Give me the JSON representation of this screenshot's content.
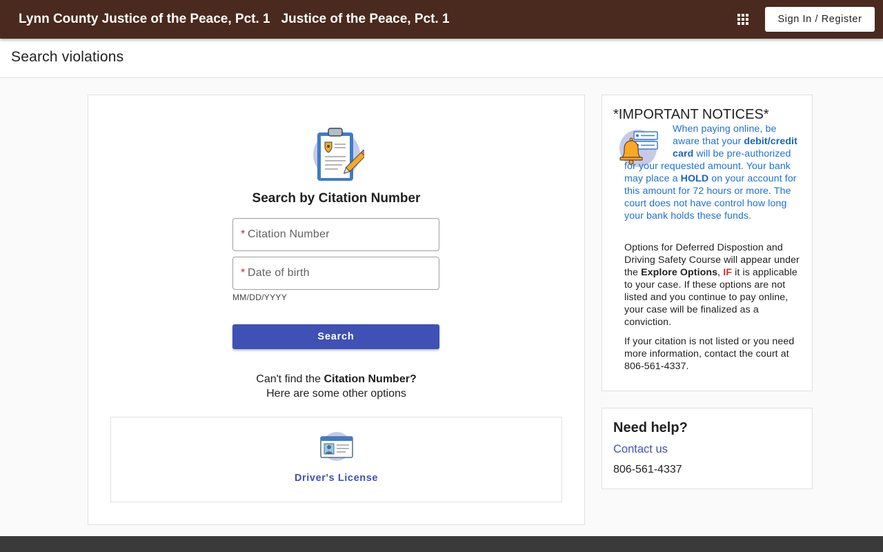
{
  "header": {
    "court_name": "Lynn County Justice of the Peace, Pct. 1",
    "court_subtitle": "Justice of the Peace, Pct. 1",
    "apps_icon": "apps-grid-icon",
    "signin_label": "Sign In / Register",
    "bar_color": "#4a2a1e"
  },
  "page": {
    "title": "Search violations"
  },
  "search": {
    "icon": "clipboard-badge-pencil-icon",
    "heading": "Search by Citation Number",
    "citation_required_mark": "*",
    "citation_placeholder": "Citation Number",
    "dob_required_mark": "*",
    "dob_placeholder": "Date of birth",
    "dob_hint": "MM/DD/YYYY",
    "button_label": "Search",
    "button_color": "#3f51b5",
    "cant_find_prefix": "Can't find the ",
    "cant_find_bold": "Citation Number?",
    "other_options": "Here are some other options",
    "alt_option": {
      "icon": "id-card-icon",
      "label": "Driver's License"
    }
  },
  "notices": {
    "heading": "*IMPORTANT NOTICES*",
    "icon": "bell-notification-icon",
    "hold": {
      "t1": "When paying online, be aware that your ",
      "b1": "debit/credit card",
      "t2": " will be pre-authorized for your requested amount. Your bank may place a ",
      "b2": "HOLD",
      "t3": " on your account for this amount for 72 hours or more. The court does not have control how long your bank holds these funds."
    },
    "options": {
      "t1": "Options for Deferred Dispostion and Driving Safety Course will appear under the ",
      "b1": "Explore Options",
      "t2": ", ",
      "red": "IF",
      "t3": " it is applicable to your case. If these options are not listed and you continue to pay online, your case will be finalized as a conviction."
    },
    "contact_text": "If your citation is not listed or you need more information, contact the court at 806-561-4337."
  },
  "help": {
    "heading": "Need help?",
    "contact_link": "Contact us",
    "phone": "806-561-4337"
  }
}
